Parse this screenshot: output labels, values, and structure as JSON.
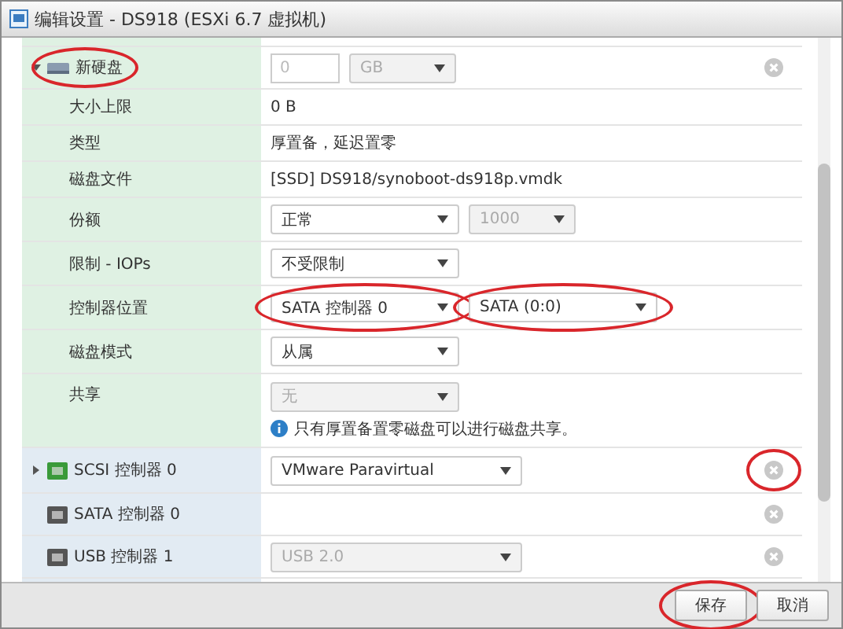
{
  "window": {
    "title": "编辑设置 - DS918 (ESXi 6.7 虚拟机)"
  },
  "rows": [
    {
      "kind": "disk",
      "label": "新硬盘",
      "expanded": true,
      "circled": true,
      "size": {
        "value": "0",
        "disabled": true
      },
      "unit": {
        "value": "GB",
        "disabled": true
      },
      "removable": true,
      "remove_circled": false
    },
    {
      "kind": "text",
      "label": "大小上限",
      "value": "0 B"
    },
    {
      "kind": "text",
      "label": "类型",
      "value": "厚置备，延迟置零"
    },
    {
      "kind": "text",
      "label": "磁盘文件",
      "value": "[SSD] DS918/synoboot-ds918p.vmdk"
    },
    {
      "kind": "select",
      "label": "份额",
      "selects": [
        {
          "value": "正常",
          "disabled": false,
          "circled": false
        },
        {
          "value": "1000",
          "disabled": true,
          "circled": false
        }
      ]
    },
    {
      "kind": "select",
      "label": "限制 - IOPs",
      "selects": [
        {
          "value": "不受限制",
          "disabled": false,
          "circled": false
        }
      ]
    },
    {
      "kind": "select",
      "label": "控制器位置",
      "selects": [
        {
          "value": "SATA 控制器 0",
          "disabled": false,
          "circled": true
        },
        {
          "value": "SATA (0:0)",
          "disabled": false,
          "circled": true
        }
      ]
    },
    {
      "kind": "select",
      "label": "磁盘模式",
      "selects": [
        {
          "value": "从属",
          "disabled": false,
          "circled": false
        }
      ]
    },
    {
      "kind": "share",
      "label": "共享",
      "selects": [
        {
          "value": "无",
          "disabled": true,
          "circled": false
        }
      ],
      "note": "只有厚置备置零磁盘可以进行磁盘共享。"
    },
    {
      "kind": "device",
      "label": "SCSI 控制器 0",
      "expandable": true,
      "select": {
        "value": "VMware Paravirtual",
        "disabled": false
      },
      "removable": true,
      "remove_circled": true
    },
    {
      "kind": "device",
      "label": "SATA 控制器 0",
      "expandable": false,
      "removable": true,
      "remove_circled": false
    },
    {
      "kind": "device",
      "label": "USB 控制器 1",
      "expandable": false,
      "select": {
        "value": "USB 2.0",
        "disabled": true
      },
      "removable": true,
      "remove_circled": false
    }
  ],
  "buttons": [
    {
      "label": "保存",
      "circled": true
    },
    {
      "label": "取消",
      "circled": false
    }
  ]
}
